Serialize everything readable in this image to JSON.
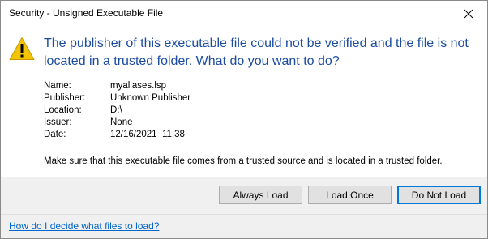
{
  "window": {
    "title": "Security - Unsigned Executable File"
  },
  "icons": {
    "close": "close-icon",
    "warning": "warning-icon"
  },
  "main_instruction": "The publisher of this executable file could not be verified and the file is not located in a trusted folder. What do you want to do?",
  "details": [
    {
      "key": "Name:",
      "value": "myaliases.lsp"
    },
    {
      "key": "Publisher:",
      "value": "Unknown Publisher"
    },
    {
      "key": "Location:",
      "value": "D:\\"
    },
    {
      "key": "Issuer:",
      "value": "None"
    },
    {
      "key": "Date:",
      "value": "12/16/2021  11:38"
    }
  ],
  "note": "Make sure that this executable file comes from a trusted source and is located in a trusted folder.",
  "buttons": {
    "always_load": "Always Load",
    "load_once": "Load Once",
    "do_not_load": "Do Not Load"
  },
  "footer": {
    "help_link": "How do I decide what files to load?"
  },
  "colors": {
    "instruction_text": "#1b4ca0",
    "link": "#0066cc",
    "warning_fill": "#f5c400",
    "default_button_border": "#0078d7"
  }
}
